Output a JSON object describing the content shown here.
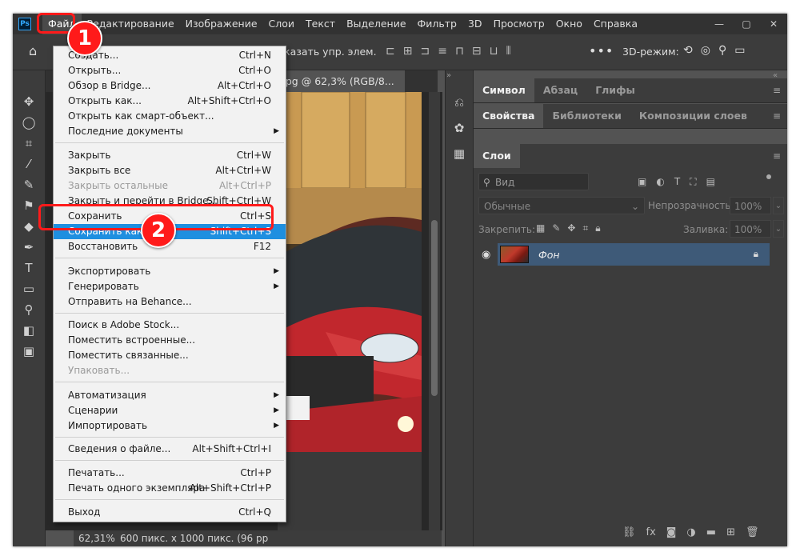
{
  "app": {
    "logo": "Ps",
    "menu": [
      "Файл",
      "Редактирование",
      "Изображение",
      "Слои",
      "Текст",
      "Выделение",
      "Фильтр",
      "3D",
      "Просмотр",
      "Окно",
      "Справка"
    ],
    "window_controls": [
      "—",
      "▢",
      "✕"
    ]
  },
  "options_bar": {
    "show_controls": "Показать упр. элем.",
    "mode_3d": "3D-режим:"
  },
  "document": {
    "tab_title": "o.jpg @ 62,3% (RGB/8..."
  },
  "status": {
    "zoom": "62,31%",
    "info": "600 пикс. x 1000 пикс. (96 pp"
  },
  "panels": {
    "top_tabs": [
      "Символ",
      "Абзац",
      "Глифы"
    ],
    "mid_tabs": [
      "Свойства",
      "Библиотеки",
      "Композиции слоев"
    ],
    "layers_tab": "Слои"
  },
  "layers": {
    "search_placeholder": "Вид",
    "blend_mode": "Обычные",
    "opacity_label": "Непрозрачность:",
    "opacity_value": "100%",
    "lock_label": "Закрепить:",
    "fill_label": "Заливка:",
    "fill_value": "100%",
    "items": [
      {
        "name": "Фон"
      }
    ]
  },
  "file_menu": {
    "items": [
      {
        "label": "Создать...",
        "shortcut": "Ctrl+N"
      },
      {
        "label": "Открыть...",
        "shortcut": "Ctrl+O"
      },
      {
        "label": "Обзор в Bridge...",
        "shortcut": "Alt+Ctrl+O"
      },
      {
        "label": "Открыть как...",
        "shortcut": "Alt+Shift+Ctrl+O"
      },
      {
        "label": "Открыть как смарт-объект...",
        "shortcut": ""
      },
      {
        "label": "Последние документы",
        "shortcut": ""
      },
      {
        "label": "Закрыть",
        "shortcut": "Ctrl+W"
      },
      {
        "label": "Закрыть все",
        "shortcut": "Alt+Ctrl+W"
      },
      {
        "label": "Закрыть остальные",
        "shortcut": "Alt+Ctrl+P"
      },
      {
        "label": "Закрыть и перейти в Bridge...",
        "shortcut": "Shift+Ctrl+W"
      },
      {
        "label": "Сохранить",
        "shortcut": "Ctrl+S"
      },
      {
        "label": "Сохранить как...",
        "shortcut": "Shift+Ctrl+S"
      },
      {
        "label": "Восстановить",
        "shortcut": "F12"
      },
      {
        "label": "Экспортировать",
        "shortcut": ""
      },
      {
        "label": "Генерировать",
        "shortcut": ""
      },
      {
        "label": "Отправить на Behance...",
        "shortcut": ""
      },
      {
        "label": "Поиск в Adobe Stock...",
        "shortcut": ""
      },
      {
        "label": "Поместить встроенные...",
        "shortcut": ""
      },
      {
        "label": "Поместить связанные...",
        "shortcut": ""
      },
      {
        "label": "Упаковать...",
        "shortcut": ""
      },
      {
        "label": "Автоматизация",
        "shortcut": ""
      },
      {
        "label": "Сценарии",
        "shortcut": ""
      },
      {
        "label": "Импортировать",
        "shortcut": ""
      },
      {
        "label": "Сведения о файле...",
        "shortcut": "Alt+Shift+Ctrl+I"
      },
      {
        "label": "Печатать...",
        "shortcut": "Ctrl+P"
      },
      {
        "label": "Печать одного экземпляра",
        "shortcut": "Alt+Shift+Ctrl+P"
      },
      {
        "label": "Выход",
        "shortcut": "Ctrl+Q"
      }
    ]
  },
  "annotations": {
    "step1": "1",
    "step2": "2",
    "color": "#ff1a1a"
  },
  "colors": {
    "highlight": "#1e8fe0",
    "layer_selected": "#3e5a78",
    "panel_dark": "#3c3c3c",
    "menubar": "#323232"
  }
}
